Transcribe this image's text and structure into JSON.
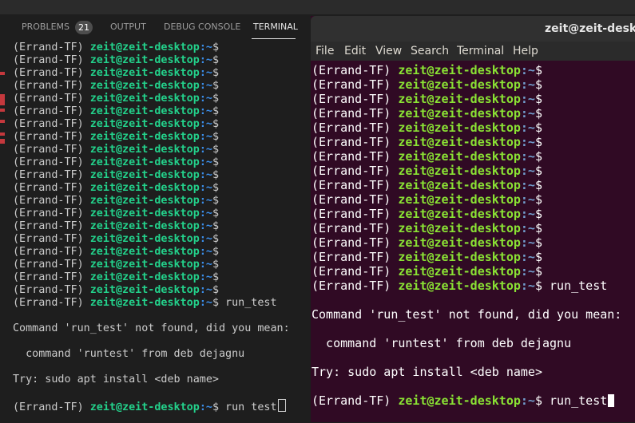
{
  "vscode": {
    "tabs": {
      "problems": "PROBLEMS",
      "problems_count": "21",
      "output": "OUTPUT",
      "debug_console": "DEBUG CONSOLE",
      "terminal": "TERMINAL"
    },
    "terminal": {
      "empty_prompt_count": 20,
      "prompt_env": "(Errand-TF) ",
      "prompt_user": "zeit@zeit-desktop",
      "prompt_path": ":~",
      "prompt_symbol": "$",
      "command_run": " run_test",
      "error_line": "Command 'run_test' not found, did you mean:",
      "suggestion_line": "  command 'runtest' from deb dejagnu",
      "try_line": "Try: sudo apt install <deb name>",
      "current_input": " run test"
    }
  },
  "gnome": {
    "title": "zeit@zeit-desktop",
    "menu": [
      "File",
      "Edit",
      "View",
      "Search",
      "Terminal",
      "Help"
    ],
    "terminal": {
      "empty_prompt_count": 15,
      "prompt_env": "(Errand-TF) ",
      "prompt_user": "zeit@zeit-desktop",
      "prompt_path": ":~",
      "prompt_symbol": "$",
      "command_run": " run_test",
      "error_line": "Command 'run_test' not found, did you mean:",
      "suggestion_line": "  command 'runtest' from deb dejagnu",
      "try_line": "Try: sudo apt install <deb name>",
      "current_input": " run_test"
    }
  },
  "colors": {
    "vscode_bg": "#1e1e1e",
    "vscode_user": "#23d18b",
    "vscode_path": "#3b8eea",
    "gnome_bg": "#300a24",
    "gnome_user": "#8ae234",
    "gnome_path": "#729fcf"
  }
}
